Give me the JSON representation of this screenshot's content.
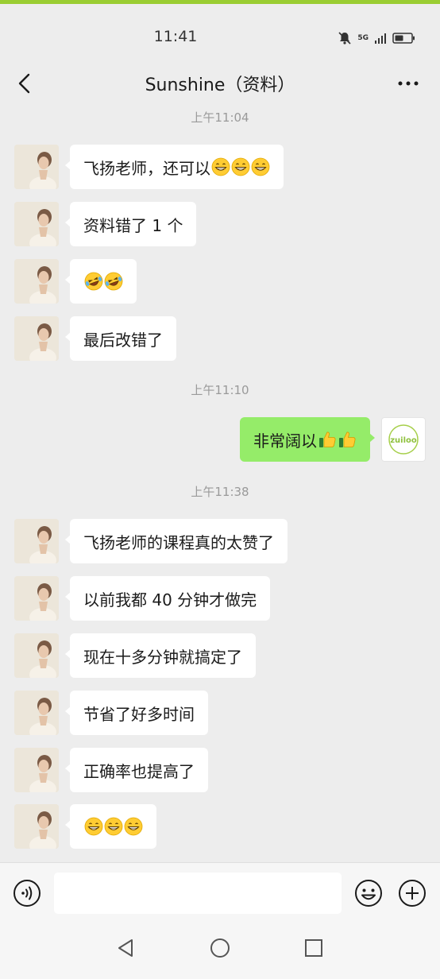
{
  "status_bar": {
    "time": "11:41",
    "network_label": "5G",
    "icons": [
      "mute-bell-icon",
      "signal-icon",
      "battery-icon"
    ]
  },
  "header": {
    "title": "Sunshine（资料）",
    "back_icon": "chevron-left-icon",
    "more_icon": "more-icon"
  },
  "chat": {
    "timestamps": [
      "上午11:04",
      "上午11:10",
      "上午11:38"
    ],
    "messages": [
      {
        "from": "other",
        "text": "飞扬老师，还可以",
        "emoji": [
          "grin",
          "grin",
          "grin"
        ]
      },
      {
        "from": "other",
        "text": "资料错了 1 个",
        "emoji": []
      },
      {
        "from": "other",
        "text": "",
        "emoji": [
          "laugh-cry",
          "laugh-cry"
        ]
      },
      {
        "from": "other",
        "text": "最后改错了",
        "emoji": []
      },
      {
        "from": "me",
        "text": "非常阔以",
        "emoji": [
          "thumbs-up",
          "thumbs-up"
        ]
      },
      {
        "from": "other",
        "text": "飞扬老师的课程真的太赞了",
        "emoji": []
      },
      {
        "from": "other",
        "text": "以前我都 40 分钟才做完",
        "emoji": []
      },
      {
        "from": "other",
        "text": "现在十多分钟就搞定了",
        "emoji": []
      },
      {
        "from": "other",
        "text": "节省了好多时间",
        "emoji": []
      },
      {
        "from": "other",
        "text": "正确率也提高了",
        "emoji": []
      },
      {
        "from": "other",
        "text": "",
        "emoji": [
          "grin",
          "grin",
          "grin"
        ]
      }
    ],
    "my_avatar_logo": "zuiloo"
  },
  "input_bar": {
    "value": "",
    "placeholder": "",
    "icons": [
      "voice-icon",
      "emoji-icon",
      "plus-icon"
    ]
  },
  "system_nav": {
    "icons": [
      "back-triangle-icon",
      "home-circle-icon",
      "recents-square-icon"
    ]
  },
  "colors": {
    "accent_bar": "#9acd32",
    "my_bubble": "#95ec69",
    "other_bubble": "#ffffff",
    "background": "#ededed"
  }
}
